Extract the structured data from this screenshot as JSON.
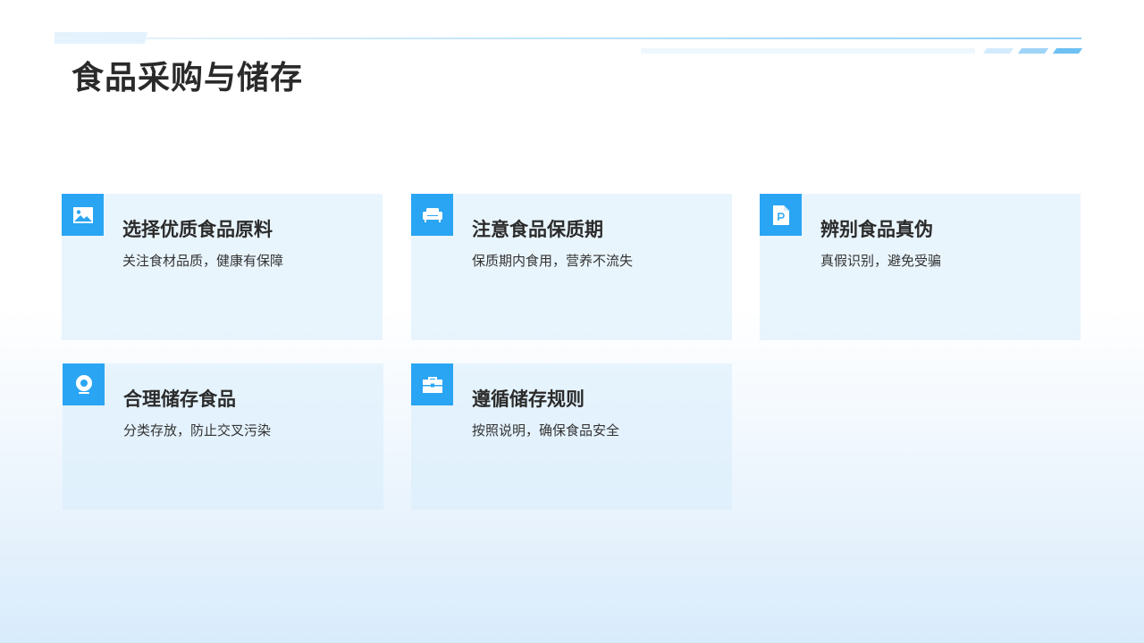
{
  "page": {
    "title": "食品采购与储存"
  },
  "cards": [
    {
      "icon": "image-icon",
      "title": "选择优质食品原料",
      "desc": "关注食材品质，健康有保障"
    },
    {
      "icon": "sofa-icon",
      "title": "注意食品保质期",
      "desc": "保质期内食用，营养不流失"
    },
    {
      "icon": "document-icon",
      "title": "辨别食品真伪",
      "desc": "真假识别，避免受骗"
    },
    {
      "icon": "webcam-icon",
      "title": "合理储存食品",
      "desc": "分类存放，防止交叉污染"
    },
    {
      "icon": "briefcase-icon",
      "title": "遵循储存规则",
      "desc": "按照说明，确保食品安全"
    }
  ],
  "colors": {
    "accent": "#2aa5f3",
    "card_bg": "#e6f3fd",
    "title_text": "#2a2a2a"
  }
}
